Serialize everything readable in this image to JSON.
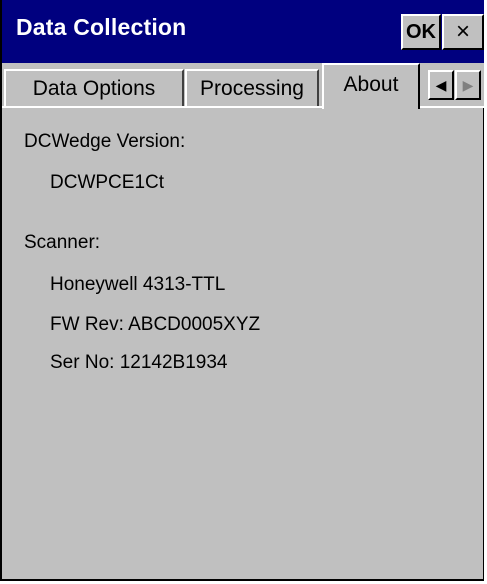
{
  "window": {
    "title": "Data Collection"
  },
  "titlebar": {
    "ok_label": "OK",
    "close_label": "×"
  },
  "tabs": [
    {
      "label": "Data Options",
      "active": false
    },
    {
      "label": "Processing",
      "active": false
    },
    {
      "label": "About",
      "active": true
    }
  ],
  "tab_scroll": {
    "left_icon": "◀",
    "right_icon": "▶"
  },
  "about": {
    "version_label": "DCWedge Version:",
    "version_value": "DCWPCE1Ct",
    "scanner_label": "Scanner:",
    "scanner_model": "Honeywell 4313-TTL",
    "fw_rev": "FW Rev: ABCD0005XYZ",
    "ser_no": "Ser No: 12142B1934"
  },
  "colors": {
    "titlebar": "#00007f",
    "face": "#c0c0c0",
    "title_text": "#ffffff"
  }
}
